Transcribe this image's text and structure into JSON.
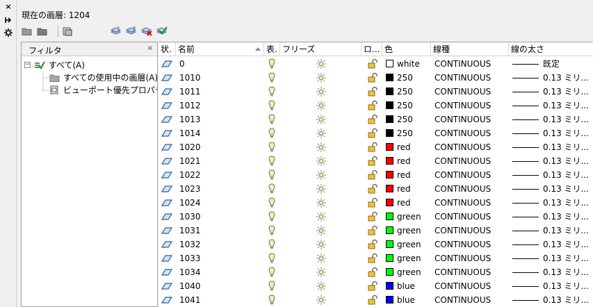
{
  "side_strip": {
    "close_icon": "×",
    "autohide_icon": "pin-icon",
    "properties_icon": "gear-icon"
  },
  "current_layer": "現在の画層: 1204",
  "filter_pane": {
    "header": "フィルタ",
    "collapse_glyph": "«",
    "tree": [
      {
        "label": "すべて(A)",
        "level": 0,
        "expander": "−"
      },
      {
        "label": "すべての使用中の画層(A)",
        "level": 1
      },
      {
        "label": "ビューポート優先プロパティ",
        "level": 1
      }
    ]
  },
  "columns": {
    "status": "状.",
    "name": "名前",
    "on": "表.",
    "freeze": "フリーズ",
    "lock": "ロ...",
    "color": "色",
    "linetype": "線種",
    "lineweight": "線の太さ"
  },
  "layers": [
    {
      "name": "0",
      "color_name": "white",
      "color_hex": "#ffffff",
      "linetype": "CONTINUOUS",
      "lineweight": "既定"
    },
    {
      "name": "1010",
      "color_name": "250",
      "color_hex": "#000000",
      "linetype": "CONTINUOUS",
      "lineweight": "0.13 ミリ..."
    },
    {
      "name": "1011",
      "color_name": "250",
      "color_hex": "#000000",
      "linetype": "CONTINUOUS",
      "lineweight": "0.13 ミリ..."
    },
    {
      "name": "1012",
      "color_name": "250",
      "color_hex": "#000000",
      "linetype": "CONTINUOUS",
      "lineweight": "0.13 ミリ..."
    },
    {
      "name": "1013",
      "color_name": "250",
      "color_hex": "#000000",
      "linetype": "CONTINUOUS",
      "lineweight": "0.13 ミリ..."
    },
    {
      "name": "1014",
      "color_name": "250",
      "color_hex": "#000000",
      "linetype": "CONTINUOUS",
      "lineweight": "0.13 ミリ..."
    },
    {
      "name": "1020",
      "color_name": "red",
      "color_hex": "#ff0000",
      "linetype": "CONTINUOUS",
      "lineweight": "0.13 ミリ..."
    },
    {
      "name": "1021",
      "color_name": "red",
      "color_hex": "#ff0000",
      "linetype": "CONTINUOUS",
      "lineweight": "0.13 ミリ..."
    },
    {
      "name": "1022",
      "color_name": "red",
      "color_hex": "#ff0000",
      "linetype": "CONTINUOUS",
      "lineweight": "0.13 ミリ..."
    },
    {
      "name": "1023",
      "color_name": "red",
      "color_hex": "#ff0000",
      "linetype": "CONTINUOUS",
      "lineweight": "0.13 ミリ..."
    },
    {
      "name": "1024",
      "color_name": "red",
      "color_hex": "#ff0000",
      "linetype": "CONTINUOUS",
      "lineweight": "0.13 ミリ..."
    },
    {
      "name": "1030",
      "color_name": "green",
      "color_hex": "#00ff00",
      "linetype": "CONTINUOUS",
      "lineweight": "0.13 ミリ..."
    },
    {
      "name": "1031",
      "color_name": "green",
      "color_hex": "#00ff00",
      "linetype": "CONTINUOUS",
      "lineweight": "0.13 ミリ..."
    },
    {
      "name": "1032",
      "color_name": "green",
      "color_hex": "#00ff00",
      "linetype": "CONTINUOUS",
      "lineweight": "0.13 ミリ..."
    },
    {
      "name": "1033",
      "color_name": "green",
      "color_hex": "#00ff00",
      "linetype": "CONTINUOUS",
      "lineweight": "0.13 ミリ..."
    },
    {
      "name": "1034",
      "color_name": "green",
      "color_hex": "#00ff00",
      "linetype": "CONTINUOUS",
      "lineweight": "0.13 ミリ..."
    },
    {
      "name": "1040",
      "color_name": "blue",
      "color_hex": "#0000ff",
      "linetype": "CONTINUOUS",
      "lineweight": "0.13 ミリ..."
    },
    {
      "name": "1041",
      "color_name": "blue",
      "color_hex": "#0000ff",
      "linetype": "CONTINUOUS",
      "lineweight": "0.13 ミリ..."
    }
  ]
}
